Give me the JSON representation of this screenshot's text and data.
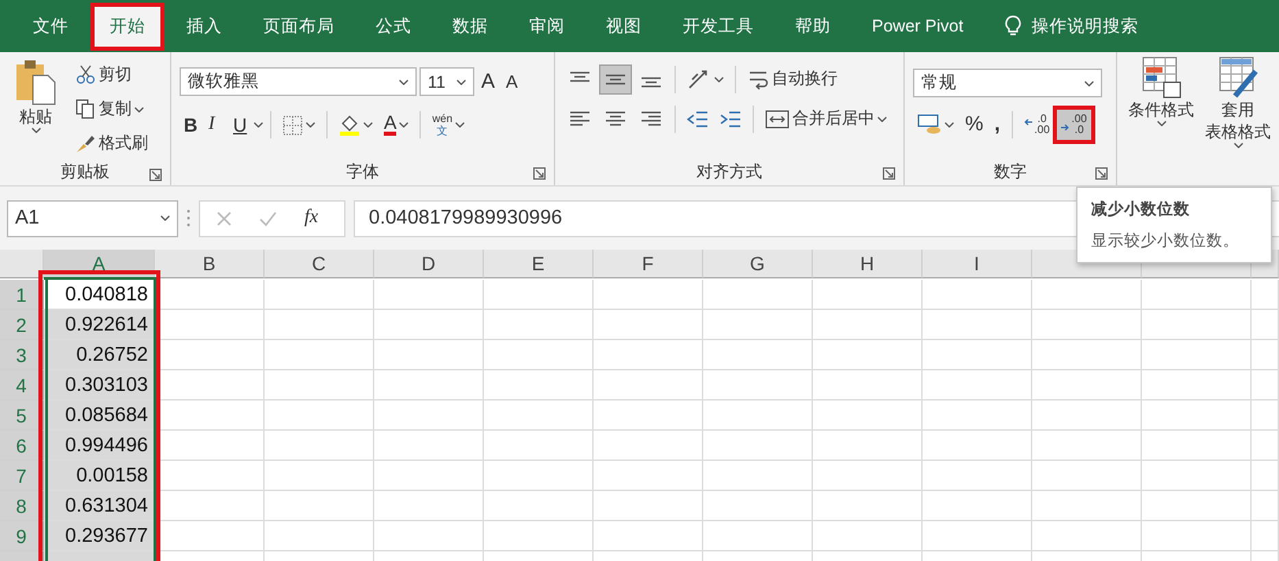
{
  "tabs": [
    {
      "label": "文件",
      "selected": false,
      "highlighted": false
    },
    {
      "label": "开始",
      "selected": true,
      "highlighted": true
    },
    {
      "label": "插入",
      "selected": false,
      "highlighted": false
    },
    {
      "label": "页面布局",
      "selected": false,
      "highlighted": false
    },
    {
      "label": "公式",
      "selected": false,
      "highlighted": false
    },
    {
      "label": "数据",
      "selected": false,
      "highlighted": false
    },
    {
      "label": "审阅",
      "selected": false,
      "highlighted": false
    },
    {
      "label": "视图",
      "selected": false,
      "highlighted": false
    },
    {
      "label": "开发工具",
      "selected": false,
      "highlighted": false
    },
    {
      "label": "帮助",
      "selected": false,
      "highlighted": false
    },
    {
      "label": "Power Pivot",
      "selected": false,
      "highlighted": false
    }
  ],
  "tell_me": "操作说明搜索",
  "clipboard": {
    "paste": "粘贴",
    "cut": "剪切",
    "copy": "复制",
    "format_painter": "格式刷",
    "label": "剪贴板"
  },
  "font": {
    "name": "微软雅黑",
    "size": "11",
    "grow": "A",
    "shrink": "A",
    "bold": "B",
    "italic": "I",
    "underline": "U",
    "font_color": "A",
    "phonetic_top": "wén",
    "phonetic_bottom": "文",
    "label": "字体"
  },
  "alignment": {
    "vertical": [
      {
        "kind": "top",
        "selected": false
      },
      {
        "kind": "middle",
        "selected": true
      },
      {
        "kind": "bottom",
        "selected": false
      }
    ],
    "horizontal": [
      {
        "kind": "left",
        "selected": false
      },
      {
        "kind": "center",
        "selected": false
      },
      {
        "kind": "right",
        "selected": false
      }
    ],
    "wrap_text": "自动换行",
    "merge": "合并后居中",
    "label": "对齐方式"
  },
  "number": {
    "format": "常规",
    "percent": "%",
    "comma": ",",
    "increase_decimal": {
      "top": ".0",
      "bottom": ".00",
      "highlighted": false
    },
    "decrease_decimal": {
      "top": ".00",
      "bottom": ".0",
      "highlighted": true
    },
    "label": "数字"
  },
  "styles": [
    {
      "lines": [
        "条件格式"
      ]
    },
    {
      "lines": [
        "套用",
        "表格格式"
      ]
    }
  ],
  "formula_bar": {
    "name_box": "A1",
    "fx": "fx",
    "value": "0.0408179989930996"
  },
  "columns": [
    {
      "label": "A",
      "selected": true,
      "highlighted": true
    },
    {
      "label": "B",
      "selected": false,
      "highlighted": false
    },
    {
      "label": "C",
      "selected": false,
      "highlighted": false
    },
    {
      "label": "D",
      "selected": false,
      "highlighted": false
    },
    {
      "label": "E",
      "selected": false,
      "highlighted": false
    },
    {
      "label": "F",
      "selected": false,
      "highlighted": false
    },
    {
      "label": "G",
      "selected": false,
      "highlighted": false
    },
    {
      "label": "H",
      "selected": false,
      "highlighted": false
    },
    {
      "label": "I",
      "selected": false,
      "highlighted": false
    },
    {
      "selected": false,
      "highlighted": false
    },
    {
      "selected": false,
      "highlighted": false
    }
  ],
  "rows": [
    {
      "label": "1",
      "selected": true,
      "active": true,
      "value": "0.040818"
    },
    {
      "label": "2",
      "selected": true,
      "active": false,
      "value": "0.922614"
    },
    {
      "label": "3",
      "selected": true,
      "active": false,
      "value": "0.26752"
    },
    {
      "label": "4",
      "selected": true,
      "active": false,
      "value": "0.303103"
    },
    {
      "label": "5",
      "selected": true,
      "active": false,
      "value": "0.085684"
    },
    {
      "label": "6",
      "selected": true,
      "active": false,
      "value": "0.994496"
    },
    {
      "label": "7",
      "selected": true,
      "active": false,
      "value": "0.00158"
    },
    {
      "label": "8",
      "selected": true,
      "active": false,
      "value": "0.631304"
    },
    {
      "label": "9",
      "selected": true,
      "active": false,
      "value": "0.293677"
    }
  ],
  "tooltip": {
    "title": "减少小数位数",
    "text": "显示较少小数位数。"
  }
}
